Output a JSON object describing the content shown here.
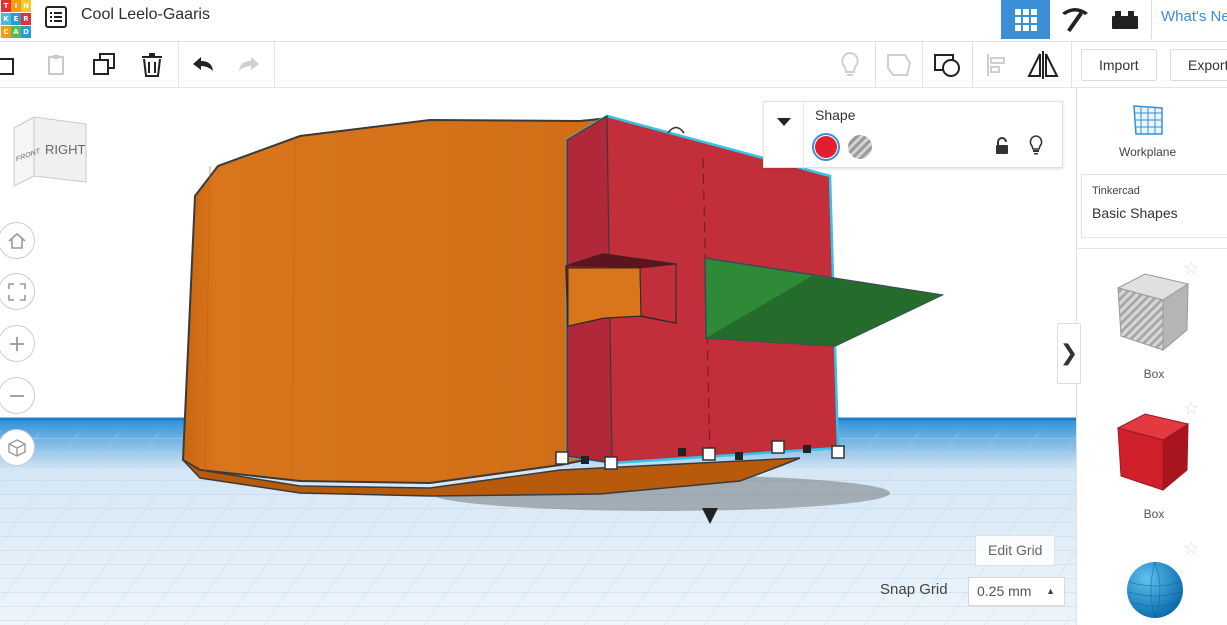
{
  "app": {
    "logo_letters": [
      "T",
      "I",
      "N",
      "K",
      "E",
      "R",
      "C",
      "A",
      "D"
    ],
    "design_title": "Cool Leelo-Gaaris",
    "whats_new": "What's New"
  },
  "topbar": {
    "views": [
      {
        "name": "3d-design-view-icon",
        "active": true
      },
      {
        "name": "blocks-view-icon",
        "active": false
      },
      {
        "name": "bricks-view-icon",
        "active": false
      }
    ]
  },
  "toolbar": {
    "left_tools": [
      "copy-icon",
      "paste-icon",
      "duplicate-icon",
      "delete-icon",
      "undo-icon",
      "redo-icon"
    ],
    "right_tools": [
      "show-all-icon",
      "hide-icon",
      "group-icon",
      "align-icon",
      "mirror-icon"
    ],
    "import_label": "Import",
    "export_label": "Export"
  },
  "viewcube": {
    "front": "FRONT",
    "right": "RIGHT"
  },
  "nav_controls": [
    "home-view-icon",
    "fit-all-icon",
    "zoom-in-icon",
    "zoom-out-icon",
    "perspective-icon"
  ],
  "shape_inspector": {
    "title": "Shape",
    "solid_color": "#e31e2d",
    "mode": "solid"
  },
  "grid": {
    "edit_grid_label": "Edit Grid",
    "snap_grid_label": "Snap Grid",
    "snap_grid_value": "0.25 mm"
  },
  "right_panel": {
    "workplane_label": "Workplane",
    "library_small": "Tinkercad",
    "library_name": "Basic Shapes",
    "shapes": [
      {
        "label": "Box",
        "kind": "hole",
        "color": "#b9b9b9"
      },
      {
        "label": "Box",
        "kind": "solid",
        "color": "#d0202a"
      },
      {
        "label": "Sphere",
        "kind": "solid",
        "color": "#1f8fd0"
      }
    ],
    "collapse_glyph": "❯"
  },
  "scene_colors": {
    "orange_body": "#d16e17",
    "red_box": "#c22f3b",
    "green_wedge": "#2e8a37",
    "selection": "#33c3e8",
    "grid_blue": "#c7dbee"
  }
}
